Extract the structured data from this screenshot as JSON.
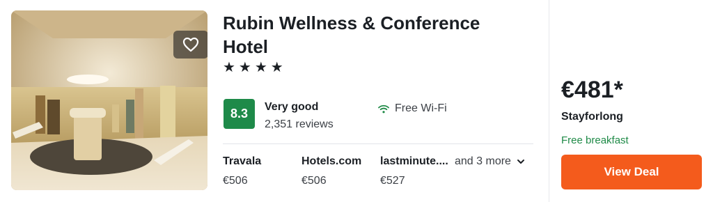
{
  "hotel": {
    "name": "Rubin Wellness & Conference Hotel",
    "stars": "★★★★"
  },
  "rating": {
    "score": "8.3",
    "label": "Very good",
    "reviews": "2,351 reviews",
    "score_color": "#1e8a49"
  },
  "amenity": {
    "label": "Free Wi-Fi",
    "icon": "wifi-icon"
  },
  "providers": [
    {
      "name": "Travala",
      "price": "€506"
    },
    {
      "name": "Hotels.com",
      "price": "€506"
    },
    {
      "name": "lastminute....",
      "price": "€527"
    }
  ],
  "more_providers": "and 3 more",
  "deal": {
    "price": "€481*",
    "site": "Stayforlong",
    "perk": "Free breakfast",
    "button_label": "View Deal",
    "button_color": "#f45b1c"
  },
  "icons": {
    "favorite": "heart-icon",
    "expand": "chevron-down-icon"
  }
}
